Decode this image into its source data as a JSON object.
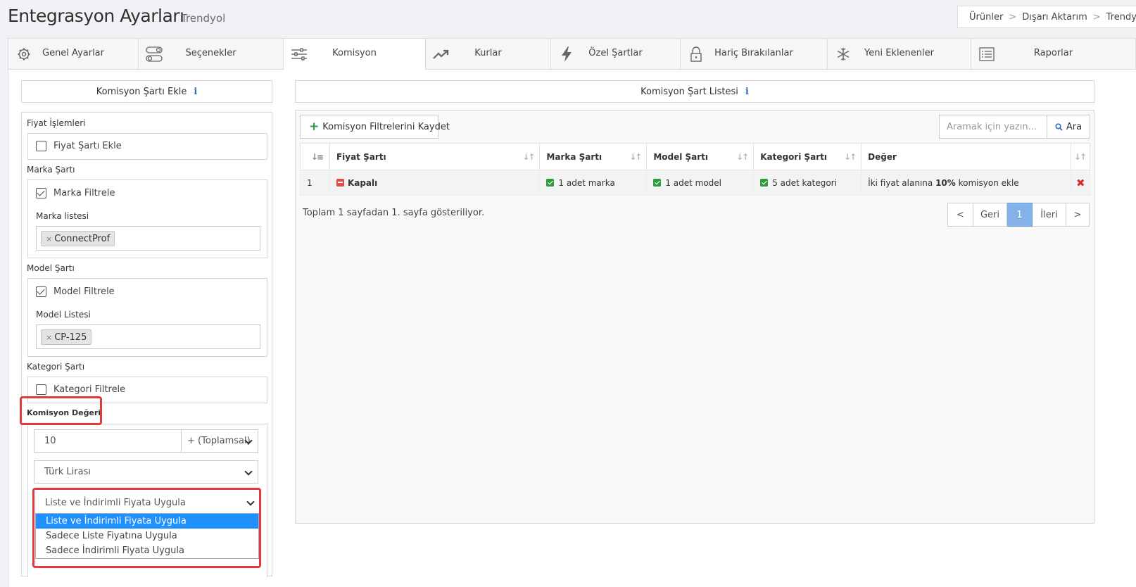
{
  "header": {
    "title": "Entegrasyon Ayarları",
    "subtitle": "Trendyol",
    "breadcrumb": [
      "Ürünler",
      "Dışarı Aktarım",
      "Trendyol"
    ],
    "breadcrumb_sep": ">"
  },
  "tabs": [
    {
      "label": "Genel Ayarlar",
      "icon": "gear-icon"
    },
    {
      "label": "Seçenekler",
      "icon": "toggles-icon"
    },
    {
      "label": "Komisyon",
      "icon": "sliders-icon",
      "active": true
    },
    {
      "label": "Kurlar",
      "icon": "trend-up-icon"
    },
    {
      "label": "Özel Şartlar",
      "icon": "bolt-icon"
    },
    {
      "label": "Hariç Bırakılanlar",
      "icon": "lock-icon"
    },
    {
      "label": "Yeni Eklenenler",
      "icon": "asterisk-icon"
    },
    {
      "label": "Raporlar",
      "icon": "list-icon"
    }
  ],
  "left_panel": {
    "title": "Komisyon Şartı Ekle",
    "info_glyph": "i",
    "fiyat_section": "Fiyat İşlemleri",
    "fiyat_checkbox": {
      "label": "Fiyat Şartı Ekle",
      "checked": false
    },
    "marka_section": "Marka Şartı",
    "marka_checkbox": {
      "label": "Marka Filtrele",
      "checked": true
    },
    "marka_list_label": "Marka listesi",
    "marka_tag": "ConnectProf",
    "model_section": "Model Şartı",
    "model_checkbox": {
      "label": "Model Filtrele",
      "checked": true
    },
    "model_list_label": "Model Listesi",
    "model_tag": "CP-125",
    "kategori_section": "Kategori Şartı",
    "kategori_checkbox": {
      "label": "Kategori Filtrele",
      "checked": false
    },
    "komisyon_section": "Komisyon Değeri",
    "komisyon_value": "10",
    "operation_select": "+ (Toplamsal)",
    "currency_select": "Türk Lirası",
    "apply_select": "Liste ve İndirimli Fiyata Uygula",
    "apply_options": [
      {
        "label": "Liste ve İndirimli Fiyata Uygula",
        "selected": true
      },
      {
        "label": "Sadece Liste Fiyatına Uygula",
        "selected": false
      },
      {
        "label": "Sadece İndirimli Fiyata Uygula",
        "selected": false
      }
    ],
    "tag_remove_glyph": "×"
  },
  "right_panel": {
    "title": "Komisyon Şart Listesi",
    "info_glyph": "i",
    "save_button": "Komisyon Filtrelerini Kaydet",
    "search_placeholder": "Aramak için yazın...",
    "search_button": "Ara",
    "columns": [
      "",
      "Fiyat Şartı",
      "Marka Şartı",
      "Model Şartı",
      "Kategori Şartı",
      "Değer",
      ""
    ],
    "rows": [
      {
        "index": "1",
        "fiyat": "Kapalı",
        "marka": "1 adet marka",
        "model": "1 adet model",
        "kategori": "5 adet kategori",
        "deger_prefix": "İki fiyat alanına",
        "deger_value": "10%",
        "deger_suffix": "komisyon ekle",
        "delete_glyph": "✖"
      }
    ],
    "pager_text": "Toplam 1 sayfadan 1. sayfa gösteriliyor.",
    "pager": {
      "first": "<",
      "prev": "Geri",
      "current": "1",
      "next": "İleri",
      "last": ">"
    }
  },
  "colors": {
    "highlight": "#e0393e",
    "selected_option": "#1e90ff",
    "active_page": "#84b1e8",
    "success": "#2d9c3c",
    "danger": "#e04a4a"
  }
}
